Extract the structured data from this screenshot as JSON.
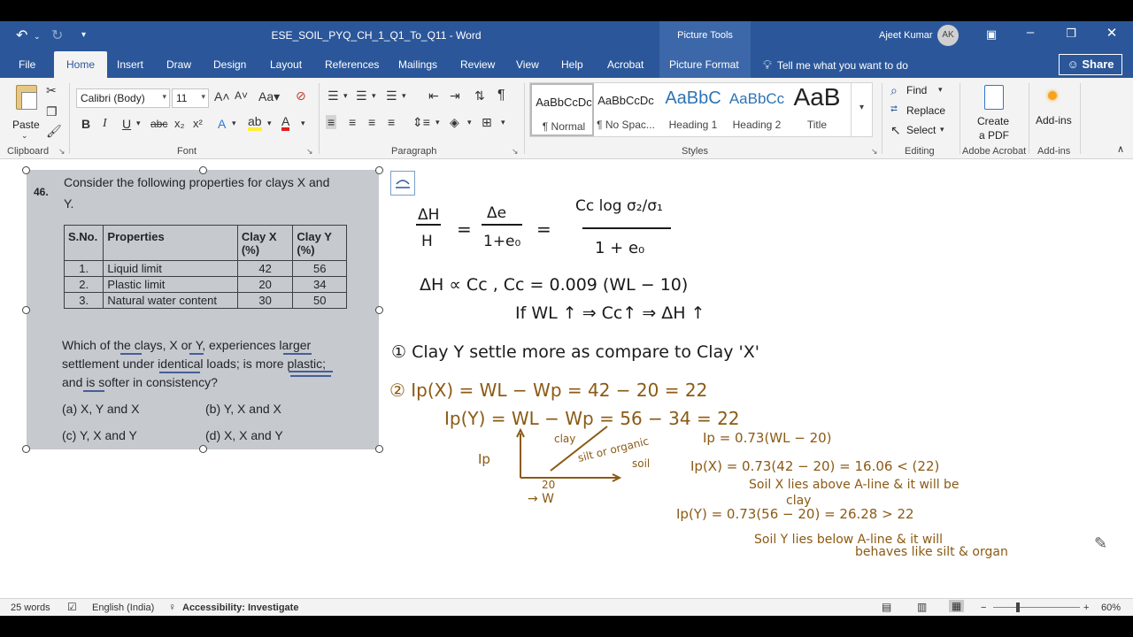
{
  "titlebar": {
    "doc_title": "ESE_SOIL_PYQ_CH_1_Q1_To_Q11  -  Word",
    "picture_tools": "Picture Tools",
    "user_name": "Ajeet Kumar",
    "user_initials": "AK"
  },
  "tabs": [
    "File",
    "Home",
    "Insert",
    "Draw",
    "Design",
    "Layout",
    "References",
    "Mailings",
    "Review",
    "View",
    "Help",
    "Acrobat",
    "Picture Format"
  ],
  "tell_me": "Tell me what you want to do",
  "share_label": "Share",
  "ribbon": {
    "clipboard": {
      "paste": "Paste",
      "label": "Clipboard"
    },
    "font": {
      "name": "Calibri (Body)",
      "size": "11",
      "label": "Font"
    },
    "paragraph": {
      "label": "Paragraph"
    },
    "styles": {
      "label": "Styles",
      "items": [
        {
          "sample": "AaBbCcDc",
          "name": "¶ Normal"
        },
        {
          "sample": "AaBbCcDc",
          "name": "¶ No Spac..."
        },
        {
          "sample": "AaBbC",
          "name": "Heading 1"
        },
        {
          "sample": "AaBbCc",
          "name": "Heading 2"
        },
        {
          "sample": "AaB",
          "name": "Title"
        }
      ]
    },
    "editing": {
      "find": "Find",
      "replace": "Replace",
      "select": "Select",
      "label": "Editing"
    },
    "adobe": {
      "create_line1": "Create",
      "create_line2": "a PDF",
      "label": "Adobe Acrobat"
    },
    "addins": {
      "button": "Add-ins",
      "label": "Add-ins"
    }
  },
  "question": {
    "number": "46.",
    "line1": "Consider the following properties for clays X and",
    "line2": "Y.",
    "table_headers": [
      "S.No.",
      "Properties",
      "Clay X (%)",
      "Clay Y (%)"
    ],
    "rows": [
      [
        "1.",
        "Liquid limit",
        "42",
        "56"
      ],
      [
        "2.",
        "Plastic limit",
        "20",
        "34"
      ],
      [
        "3.",
        "Natural water content",
        "30",
        "50"
      ]
    ],
    "body1": "Which of the clays, X or Y, experiences larger",
    "body2": "settlement under identical loads; is more plastic;",
    "body3": "and is softer in consistency?",
    "opt_a": "(a) X, Y and X",
    "opt_b": "(b)  Y, X and X",
    "opt_c": "(c) Y, X and Y",
    "opt_d": "(d)  X, X and Y"
  },
  "notes": {
    "eq1_lhs_num": "ΔH",
    "eq1_lhs_den": "H",
    "eq1_mid_num": "Δe",
    "eq1_mid_den": "1+e₀",
    "eq1_rhs_num": "Cc log σ₂/σ₁",
    "eq1_rhs_den": "1 + e₀",
    "eq2": "ΔH ∝ Cc ,  Cc = 0.009 (WL − 10)",
    "eq3": "If WL ↑ ⇒ Cc↑ ⇒ ΔH ↑",
    "point1": "① Clay Y settle more as compare to Clay 'X'",
    "point2a": "②  Ip(X) = WL − Wp = 42 − 20 = 22",
    "point2b": "Ip(Y) = WL − Wp = 56 − 34 = 22",
    "graph_ylabel": "Ip",
    "graph_clay": "clay",
    "graph_silt1": "silt or organic",
    "graph_silt2": "soil",
    "graph_x20": "20",
    "graph_xlabel": "→ W",
    "aline": "Ip = 0.73(WL − 20)",
    "ipx": "Ip(X) = 0.73(42 − 20) = 16.06 < (22)",
    "ipx_note1": "Soil X lies above A-line & it will be",
    "ipx_note2": "clay",
    "ipy": "Ip(Y) = 0.73(56 − 20) = 26.28 > 22",
    "ipy_note1": "Soil Y lies below A-line & it will",
    "ipy_note2": "behaves like silt & organ"
  },
  "status": {
    "words": "25 words",
    "language": "English (India)",
    "accessibility": "Accessibility: Investigate",
    "zoom": "60%"
  },
  "colors": {
    "word_blue": "#2b579a",
    "ink": "#8b5a14"
  }
}
